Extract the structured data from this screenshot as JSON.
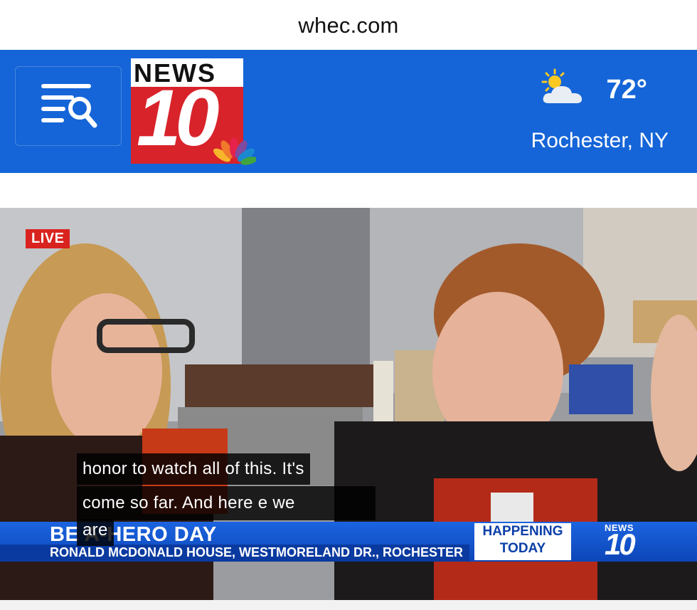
{
  "browser": {
    "url": "whec.com"
  },
  "header": {
    "menu_icon": "menu-search-icon",
    "logo": {
      "top_text": "NEWS",
      "number": "10",
      "network_icon": "peacock-icon"
    },
    "weather": {
      "icon": "partly-cloudy-icon",
      "temperature": "72°",
      "location": "Rochester, NY"
    },
    "colors": {
      "header_blue": "#1565d8",
      "logo_red": "#d8232a"
    }
  },
  "video": {
    "live_badge": "LIVE",
    "captions": [
      "honor to watch all of this. It's",
      "come so far. And here e we",
      "are"
    ],
    "lower_third": {
      "title": "BE A-HERO DAY",
      "subtitle": "RONALD MCDONALD HOUSE, WESTMORELAND DR., ROCHESTER",
      "tag_line1": "HAPPENING",
      "tag_line2": "TODAY",
      "mini_logo_top": "NEWS",
      "mini_logo_number": "10"
    }
  }
}
